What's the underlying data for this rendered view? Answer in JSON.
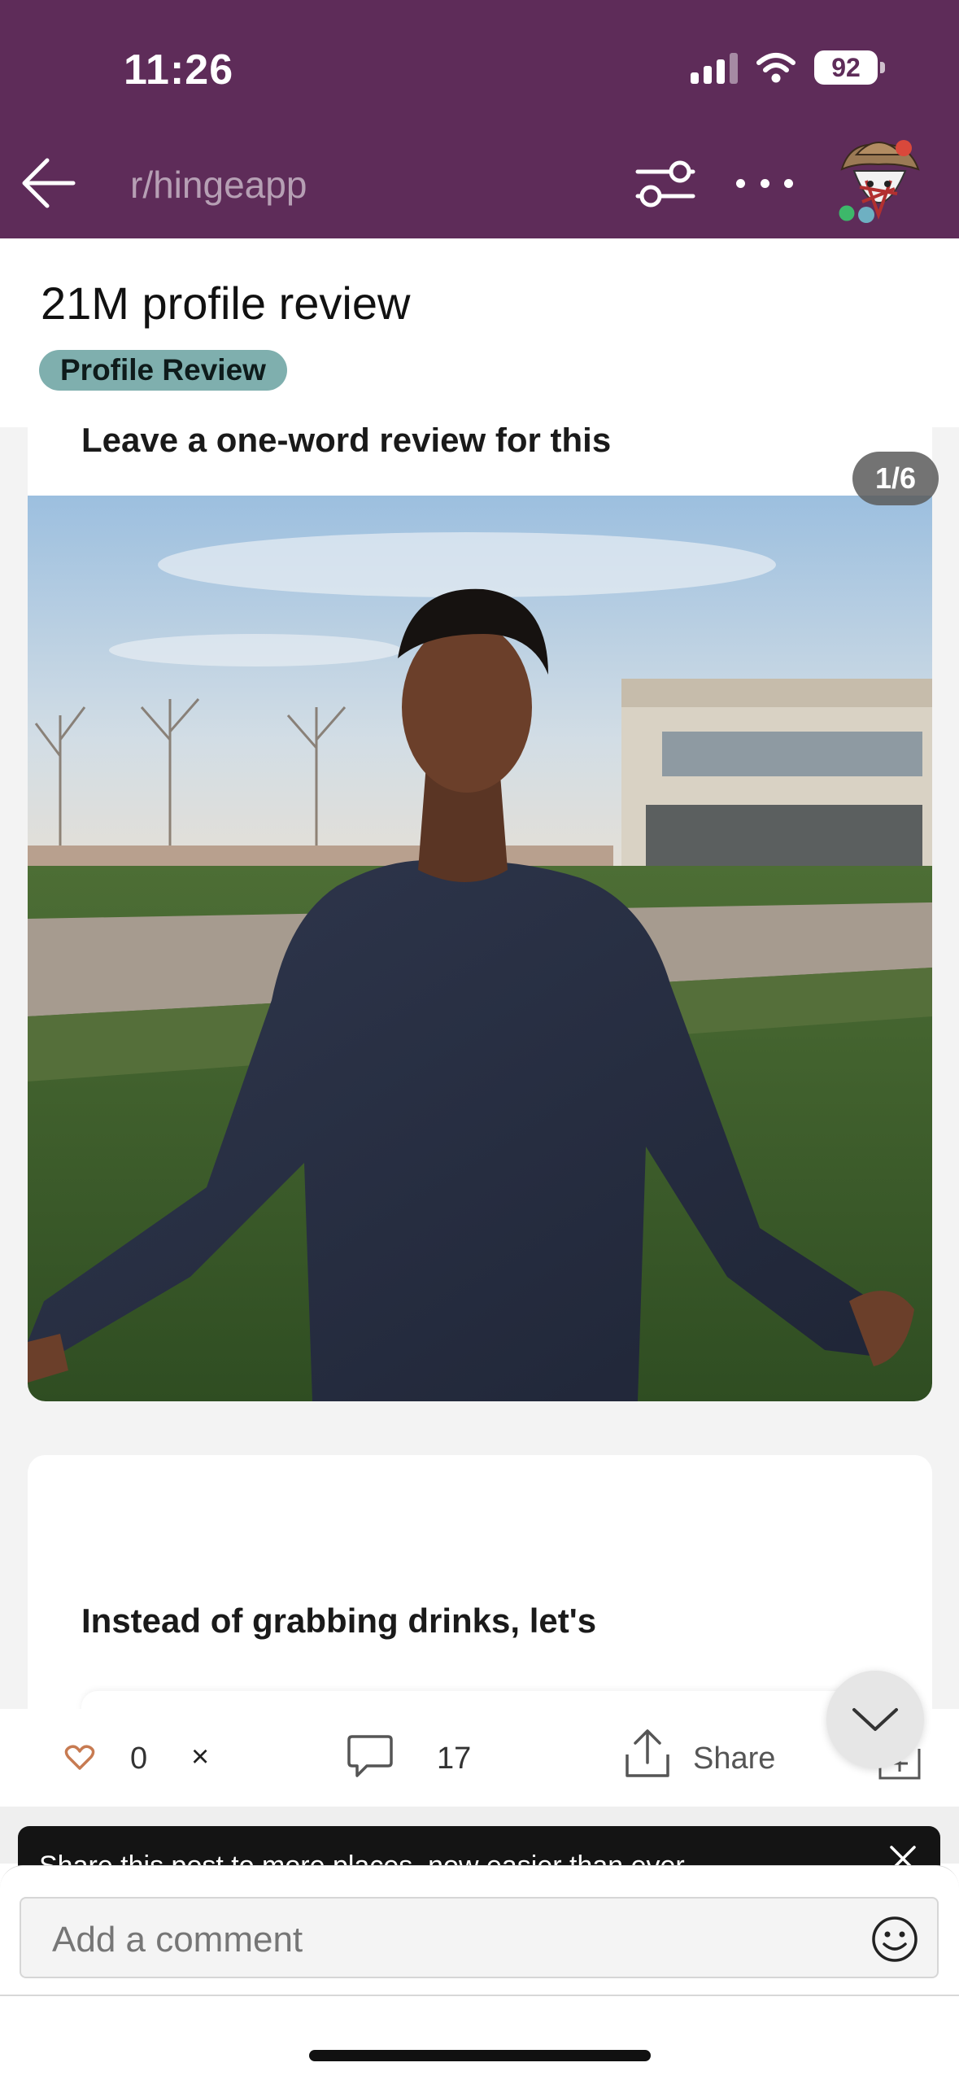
{
  "status_bar": {
    "time": "11:26",
    "battery": "92"
  },
  "nav": {
    "subreddit": "r/hingeapp",
    "icons": [
      "arrow-left-icon",
      "filter-sliders-icon",
      "more-dots-icon",
      "user-avatar"
    ]
  },
  "post": {
    "title": "21M profile review",
    "flair": "Profile Review",
    "flair_color": "#7fafae"
  },
  "carousel": {
    "counter": "1/6",
    "card1_prompt": "Leave a one-word review for this",
    "card2_prompt": "Instead of grabbing drinks, let's"
  },
  "actions": {
    "vote_count": "0",
    "vote_down_label": "×",
    "comment_count": "17",
    "share_label": "Share"
  },
  "toast": {
    "text": "Share this post to more places, now easier than ever"
  },
  "comment": {
    "placeholder": "Add a comment"
  },
  "colors": {
    "header_bg": "#5e2c59",
    "page_bg": "#f3f3f3"
  }
}
